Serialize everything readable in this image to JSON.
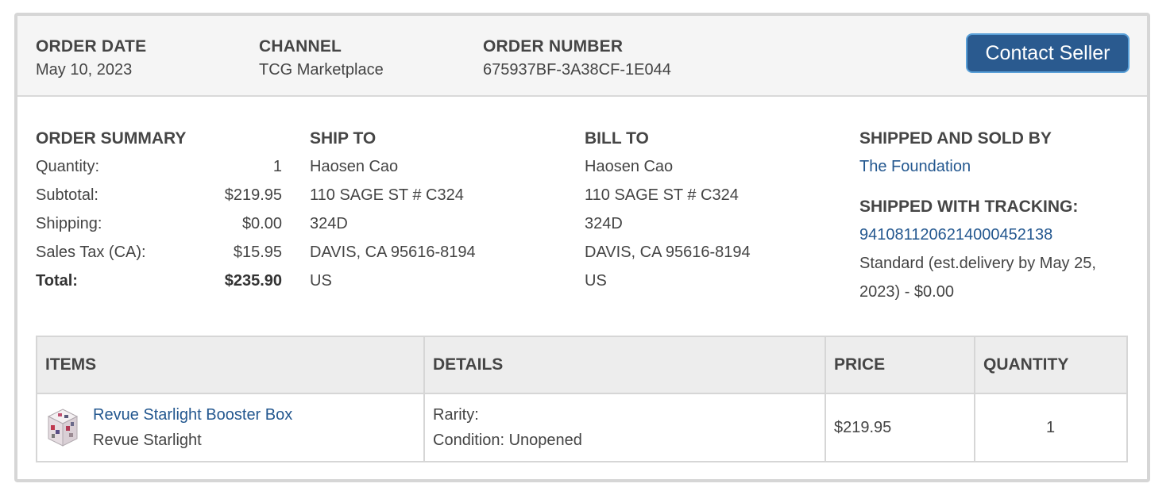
{
  "header": {
    "order_date_label": "ORDER DATE",
    "order_date": "May 10, 2023",
    "channel_label": "CHANNEL",
    "channel": "TCG Marketplace",
    "order_number_label": "ORDER NUMBER",
    "order_number": "675937BF-3A38CF-1E044",
    "contact_button": "Contact Seller"
  },
  "summary": {
    "title": "ORDER SUMMARY",
    "rows": [
      {
        "label": "Quantity:",
        "value": "1"
      },
      {
        "label": "Subtotal:",
        "value": "$219.95"
      },
      {
        "label": "Shipping:",
        "value": "$0.00"
      },
      {
        "label": "Sales Tax (CA):",
        "value": "$15.95"
      },
      {
        "label": "Total:",
        "value": "$235.90"
      }
    ]
  },
  "ship_to": {
    "title": "SHIP TO",
    "lines": [
      "Haosen Cao",
      "110 SAGE ST # C324",
      "324D",
      "DAVIS, CA 95616-8194",
      "US"
    ]
  },
  "bill_to": {
    "title": "BILL TO",
    "lines": [
      "Haosen Cao",
      "110 SAGE ST # C324",
      "324D",
      "DAVIS, CA 95616-8194",
      "US"
    ]
  },
  "seller": {
    "title": "SHIPPED AND SOLD BY",
    "name": "The Foundation",
    "tracking_title": "SHIPPED WITH TRACKING:",
    "tracking_number": "9410811206214000452138",
    "shipping_method": "Standard (est.delivery by May 25, 2023) - $0.00"
  },
  "items_table": {
    "headers": [
      "ITEMS",
      "DETAILS",
      "PRICE",
      "QUANTITY"
    ],
    "rows": [
      {
        "name": "Revue Starlight Booster Box",
        "set": "Revue Starlight",
        "rarity": "Rarity:",
        "condition": "Condition: Unopened",
        "price": "$219.95",
        "quantity": "1"
      }
    ]
  },
  "colors": {
    "accent": "#2a5a8f",
    "link": "#23578f",
    "header_bg": "#f5f5f5",
    "border": "#d6d6d6"
  },
  "icons": {
    "item_thumbnail": "booster-box-thumbnail"
  }
}
